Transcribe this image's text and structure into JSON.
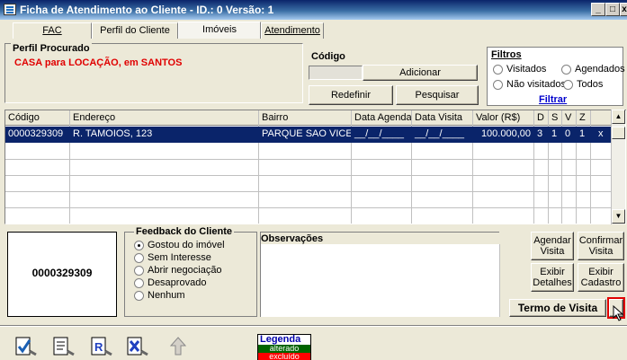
{
  "window": {
    "title": "Ficha de Atendimento ao Cliente - ID.: 0 Versão: 1",
    "btn_min": "_",
    "btn_max": "□",
    "btn_close": "x"
  },
  "tabs": [
    {
      "label": "FAC",
      "active": false
    },
    {
      "label": "Perfil do Cliente",
      "active": false
    },
    {
      "label": "Imóveis",
      "active": true
    },
    {
      "label": "Atendimento",
      "active": false
    }
  ],
  "perfil": {
    "label": "Perfil Procurado",
    "value": "CASA para LOCAÇÃO, em SANTOS"
  },
  "codigo": {
    "label": "Código",
    "value": ""
  },
  "buttons": {
    "adicionar": "Adicionar",
    "redefinir": "Redefinir",
    "pesquisar": "Pesquisar",
    "agendar": "Agendar Visita",
    "confirmar": "Confirmar Visita",
    "exibir_detalhes": "Exibir Detalhes",
    "exibir_cadastro": "Exibir Cadastro",
    "termo": "Termo de Visita",
    "termo_more": ".."
  },
  "filtros": {
    "title": "Filtros",
    "options": {
      "visitados": "Visitados",
      "agendados": "Agendados",
      "nao_visitados": "Não visitados",
      "todos": "Todos"
    },
    "filtrar": "Filtrar"
  },
  "grid": {
    "headers": [
      "Código",
      "Endereço",
      "Bairro",
      "Data Agenda",
      "Data Visita",
      "Valor (R$)",
      "D",
      "S",
      "V",
      "Z"
    ],
    "rows": [
      [
        "0000329309",
        "R. TAMOIOS, 123",
        "PARQUE SAO VICEN",
        "__/__/____",
        "__/__/____",
        "100.000,00",
        "3",
        "1",
        "0",
        "1",
        "x"
      ]
    ]
  },
  "selected_code": "0000329309",
  "feedback": {
    "label": "Feedback do Cliente",
    "options": [
      "Gostou do imóvel",
      "Sem Interesse",
      "Abrir negociação",
      "Desaprovado",
      "Nenhum"
    ],
    "selected": "Gostou do imóvel"
  },
  "observacoes": {
    "label": "Observações",
    "value": ""
  },
  "legenda": {
    "title": "Legenda",
    "alterado": "alterado",
    "excluido": "excluído",
    "alterado_color": "#006400",
    "excluido_color": "#ff0000"
  },
  "toolbar_icons": [
    "check-document-icon",
    "edit-document-icon",
    "r-document-icon",
    "x-document-icon",
    "arrow-up-icon"
  ]
}
